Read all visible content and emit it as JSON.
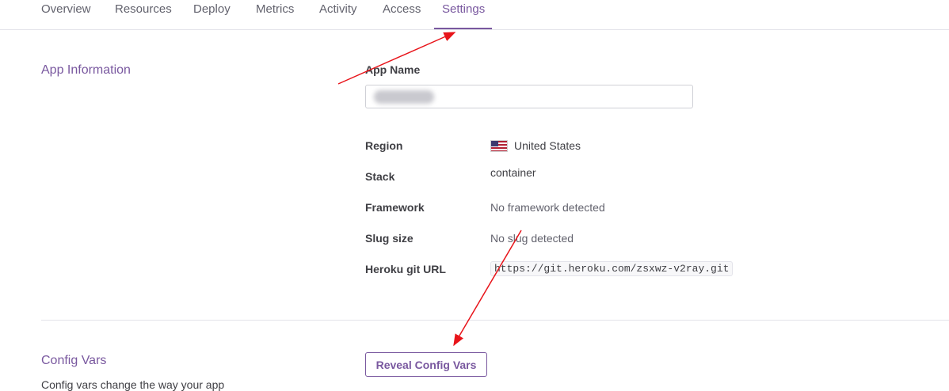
{
  "tabs": [
    "Overview",
    "Resources",
    "Deploy",
    "Metrics",
    "Activity",
    "Access",
    "Settings"
  ],
  "active_tab": "Settings",
  "app_information": {
    "title": "App Information",
    "app_name_label": "App Name",
    "region_label": "Region",
    "region_value": "United States",
    "stack_label": "Stack",
    "stack_value": "container",
    "framework_label": "Framework",
    "framework_value": "No framework detected",
    "slug_label": "Slug size",
    "slug_value": "No slug detected",
    "git_label": "Heroku git URL",
    "git_value": "https://git.heroku.com/zsxwz-v2ray.git"
  },
  "config_vars": {
    "title": "Config Vars",
    "description": "Config vars change the way your app",
    "reveal_button": "Reveal Config Vars"
  },
  "colors": {
    "accent": "#79589f",
    "annotation_arrow": "#e8141a"
  }
}
